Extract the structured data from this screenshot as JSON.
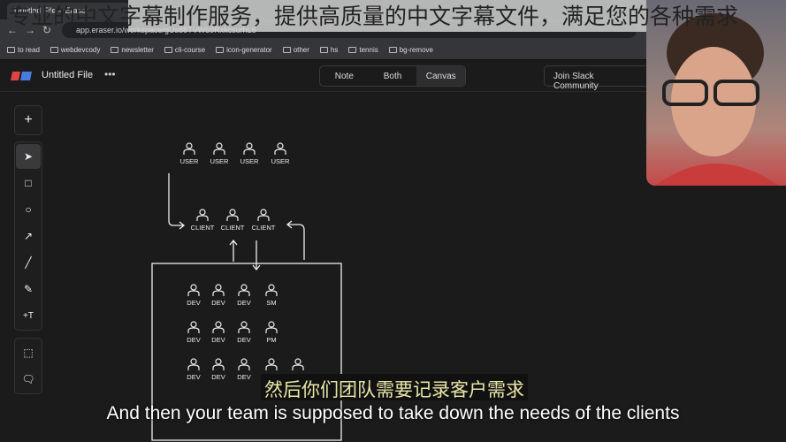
{
  "browser": {
    "tab_title": "Untitled File – Eraser",
    "url": "app.eraser.io/workspace/gUs88TVW59RxkcsurhL6",
    "bookmarks": [
      "to read",
      "webdevcody",
      "newsletter",
      "cli-course",
      "icon-generator",
      "other",
      "hs",
      "tennis",
      "bg-remove"
    ]
  },
  "app": {
    "file_title": "Untitled File",
    "menu": "•••",
    "view_tabs": [
      "Note",
      "Both",
      "Canvas"
    ],
    "active_view": "Canvas",
    "slack_button": "Join Slack Community"
  },
  "toolbar": {
    "tools": [
      "add",
      "select",
      "rectangle",
      "ellipse",
      "arrow",
      "line",
      "pencil",
      "text",
      "frame",
      "comment"
    ],
    "active": "select"
  },
  "diagram": {
    "users": [
      "USER",
      "USER",
      "USER",
      "USER"
    ],
    "clients": [
      "CLIENT",
      "CLIENT",
      "CLIENT"
    ],
    "team_rows": [
      [
        "DEV",
        "DEV",
        "DEV",
        "SM"
      ],
      [
        "DEV",
        "DEV",
        "DEV",
        "PM"
      ],
      [
        "DEV",
        "DEV",
        "DEV",
        "",
        ""
      ]
    ]
  },
  "overlay": {
    "banner_text": "专业的中文字幕制作服务，提供高质量的中文字幕文件，满足您的各种需求",
    "subtitle_zh": "然后你们团队需要记录客户需求",
    "subtitle_en": "And then your team is supposed to take down the needs of the clients"
  }
}
